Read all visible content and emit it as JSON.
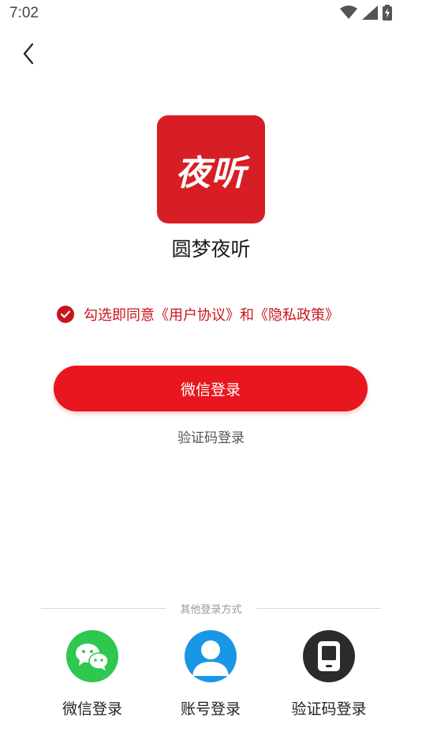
{
  "status_bar": {
    "time": "7:02",
    "icons": [
      "wifi-icon",
      "cellular-signal-icon",
      "battery-charging-icon"
    ]
  },
  "header": {
    "back_icon": "chevron-left-icon"
  },
  "app": {
    "logo_text": "夜听",
    "name": "圆梦夜听",
    "brand_color": "#d81e25"
  },
  "agreement": {
    "checked": true,
    "text": "勾选即同意《用户协议》和《隐私政策》"
  },
  "primary_login": {
    "label": "微信登录",
    "color": "#e8161f"
  },
  "secondary_login": {
    "label": "验证码登录"
  },
  "other_methods": {
    "title": "其他登录方式",
    "options": [
      {
        "label": "微信登录",
        "icon": "wechat-icon",
        "color": "#2dc84d"
      },
      {
        "label": "账号登录",
        "icon": "user-icon",
        "color": "#1a96e6"
      },
      {
        "label": "验证码登录",
        "icon": "phone-icon",
        "color": "#2b2b2b"
      }
    ]
  }
}
